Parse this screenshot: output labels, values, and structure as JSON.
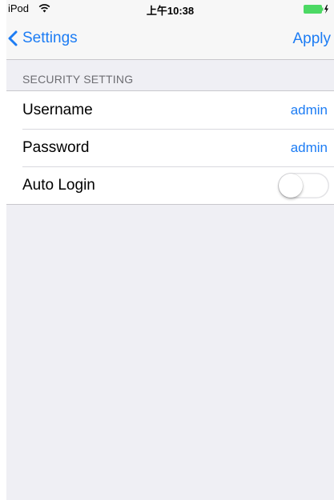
{
  "status_bar": {
    "carrier": "iPod",
    "wifi_icon": "wifi-icon",
    "time": "上午10:38",
    "battery_icon": "battery-charging-icon",
    "battery_color": "#4cd964"
  },
  "nav_bar": {
    "back_label": "Settings",
    "back_icon": "chevron-left-icon",
    "apply_label": "Apply",
    "tint_color": "#1c7cf4"
  },
  "section": {
    "title": "SECURITY SETTING"
  },
  "rows": [
    {
      "label": "Username",
      "value": "admin"
    },
    {
      "label": "Password",
      "value": "admin"
    },
    {
      "label": "Auto Login",
      "toggle_on": false
    }
  ]
}
